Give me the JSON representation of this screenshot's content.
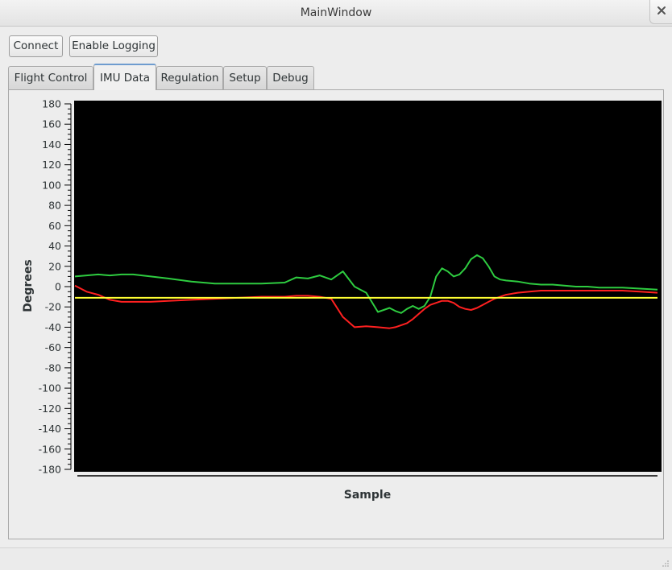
{
  "window": {
    "title": "MainWindow"
  },
  "toolbar": {
    "connect_label": "Connect",
    "logging_label": "Enable Logging"
  },
  "tabs": [
    {
      "label": "Flight Control",
      "active": false
    },
    {
      "label": "IMU Data",
      "active": true
    },
    {
      "label": "Regulation",
      "active": false
    },
    {
      "label": "Setup",
      "active": false
    },
    {
      "label": "Debug",
      "active": false
    }
  ],
  "chart_data": {
    "type": "line",
    "xlabel": "Sample",
    "ylabel": "Degrees",
    "ylim": [
      -180,
      180
    ],
    "y_ticks": [
      180,
      160,
      140,
      120,
      100,
      80,
      60,
      40,
      20,
      0,
      -20,
      -40,
      -60,
      -80,
      -100,
      -120,
      -140,
      -160,
      -180
    ],
    "x_tick_labels_shown": false,
    "background": "#000000",
    "grid": false,
    "series": [
      {
        "color": "#2ecc40",
        "x": [
          0,
          2,
          4,
          6,
          8,
          10,
          13,
          16,
          20,
          24,
          28,
          32,
          36,
          38,
          40,
          42,
          44,
          46,
          48,
          50,
          52,
          54,
          55,
          56,
          57,
          58,
          59,
          60,
          61,
          62,
          63,
          64,
          65,
          66,
          67,
          68,
          69,
          70,
          71,
          72,
          73,
          74,
          76,
          78,
          80,
          82,
          84,
          86,
          88,
          90,
          94,
          97,
          100
        ],
        "values": [
          10,
          11,
          12,
          11,
          12,
          12,
          10,
          8,
          5,
          3,
          3,
          3,
          4,
          9,
          8,
          11,
          7,
          15,
          0,
          -6,
          -25,
          -21,
          -24,
          -26,
          -22,
          -19,
          -22,
          -19,
          -10,
          10,
          18,
          15,
          10,
          12,
          18,
          27,
          31,
          28,
          20,
          10,
          7,
          6,
          5,
          3,
          2,
          2,
          1,
          0,
          0,
          -1,
          -1,
          -2,
          -3
        ]
      },
      {
        "color": "#ff2020",
        "x": [
          0,
          2,
          4,
          6,
          8,
          10,
          13,
          16,
          20,
          24,
          28,
          32,
          36,
          38,
          40,
          42,
          44,
          46,
          48,
          50,
          52,
          54,
          55,
          56,
          57,
          58,
          59,
          60,
          61,
          62,
          63,
          64,
          65,
          66,
          67,
          68,
          69,
          70,
          71,
          72,
          73,
          74,
          76,
          78,
          80,
          82,
          84,
          86,
          88,
          90,
          94,
          97,
          100
        ],
        "values": [
          1,
          -5,
          -8,
          -13,
          -15,
          -15,
          -15,
          -14,
          -13,
          -12,
          -11,
          -10,
          -10,
          -9,
          -9,
          -10,
          -12,
          -30,
          -40,
          -39,
          -40,
          -41,
          -40,
          -38,
          -36,
          -32,
          -27,
          -22,
          -18,
          -16,
          -14,
          -14,
          -16,
          -20,
          -22,
          -23,
          -21,
          -18,
          -15,
          -12,
          -10,
          -8,
          -6,
          -5,
          -4,
          -4,
          -4,
          -4,
          -4,
          -4,
          -4,
          -5,
          -6
        ]
      },
      {
        "color": "#ffff33",
        "x": [
          0,
          100
        ],
        "values": [
          -11,
          -11
        ]
      }
    ]
  }
}
